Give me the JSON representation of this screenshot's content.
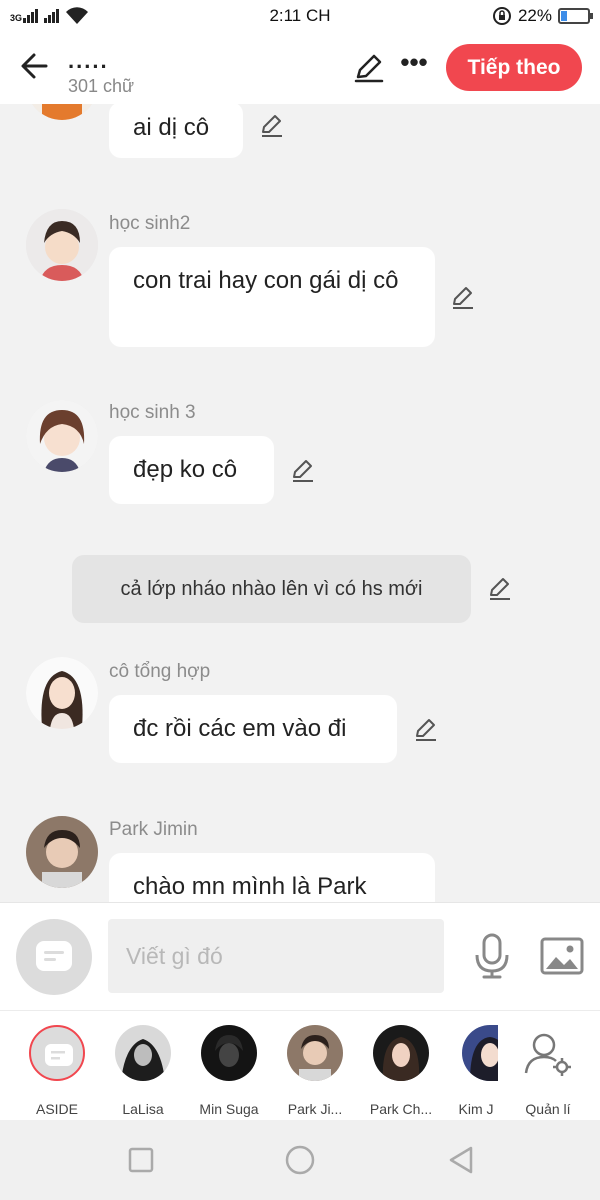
{
  "status_bar": {
    "network": "3G",
    "time": "2:11 CH",
    "battery_text": "22%",
    "battery_level": 0.22
  },
  "header": {
    "title": ".....",
    "subtitle": "301 chữ",
    "next_label": "Tiếp theo"
  },
  "messages": [
    {
      "sender": "",
      "text": "ai dị cô"
    },
    {
      "sender": "học sinh2",
      "text": "con trai hay con gái dị cô"
    },
    {
      "sender": "học sinh 3",
      "text": "đẹp ko cô"
    },
    {
      "sender": "",
      "text": "cả lớp nháo nhào lên vì có hs mới",
      "type": "narration"
    },
    {
      "sender": "cô tổng hợp",
      "text": "đc rồi các em vào đi"
    },
    {
      "sender": "Park Jimin",
      "text": "chào mn mình là Park"
    }
  ],
  "composer": {
    "placeholder": "Viết gì đó"
  },
  "characters": [
    {
      "name": "ASIDE"
    },
    {
      "name": "LaLisa"
    },
    {
      "name": "Min Suga"
    },
    {
      "name": "Park Ji..."
    },
    {
      "name": "Park Ch..."
    },
    {
      "name": "Kim J"
    }
  ],
  "manage_label": "Quản lí",
  "colors": {
    "accent": "#f1474f",
    "background": "#f2f2f2",
    "bubble": "#ffffff"
  },
  "icons": [
    "back-arrow-icon",
    "pencil-icon",
    "more-icon",
    "microphone-icon",
    "image-icon",
    "chat-bubble-icon",
    "manage-user-icon",
    "recent-apps-icon",
    "home-icon",
    "back-triangle-icon"
  ]
}
